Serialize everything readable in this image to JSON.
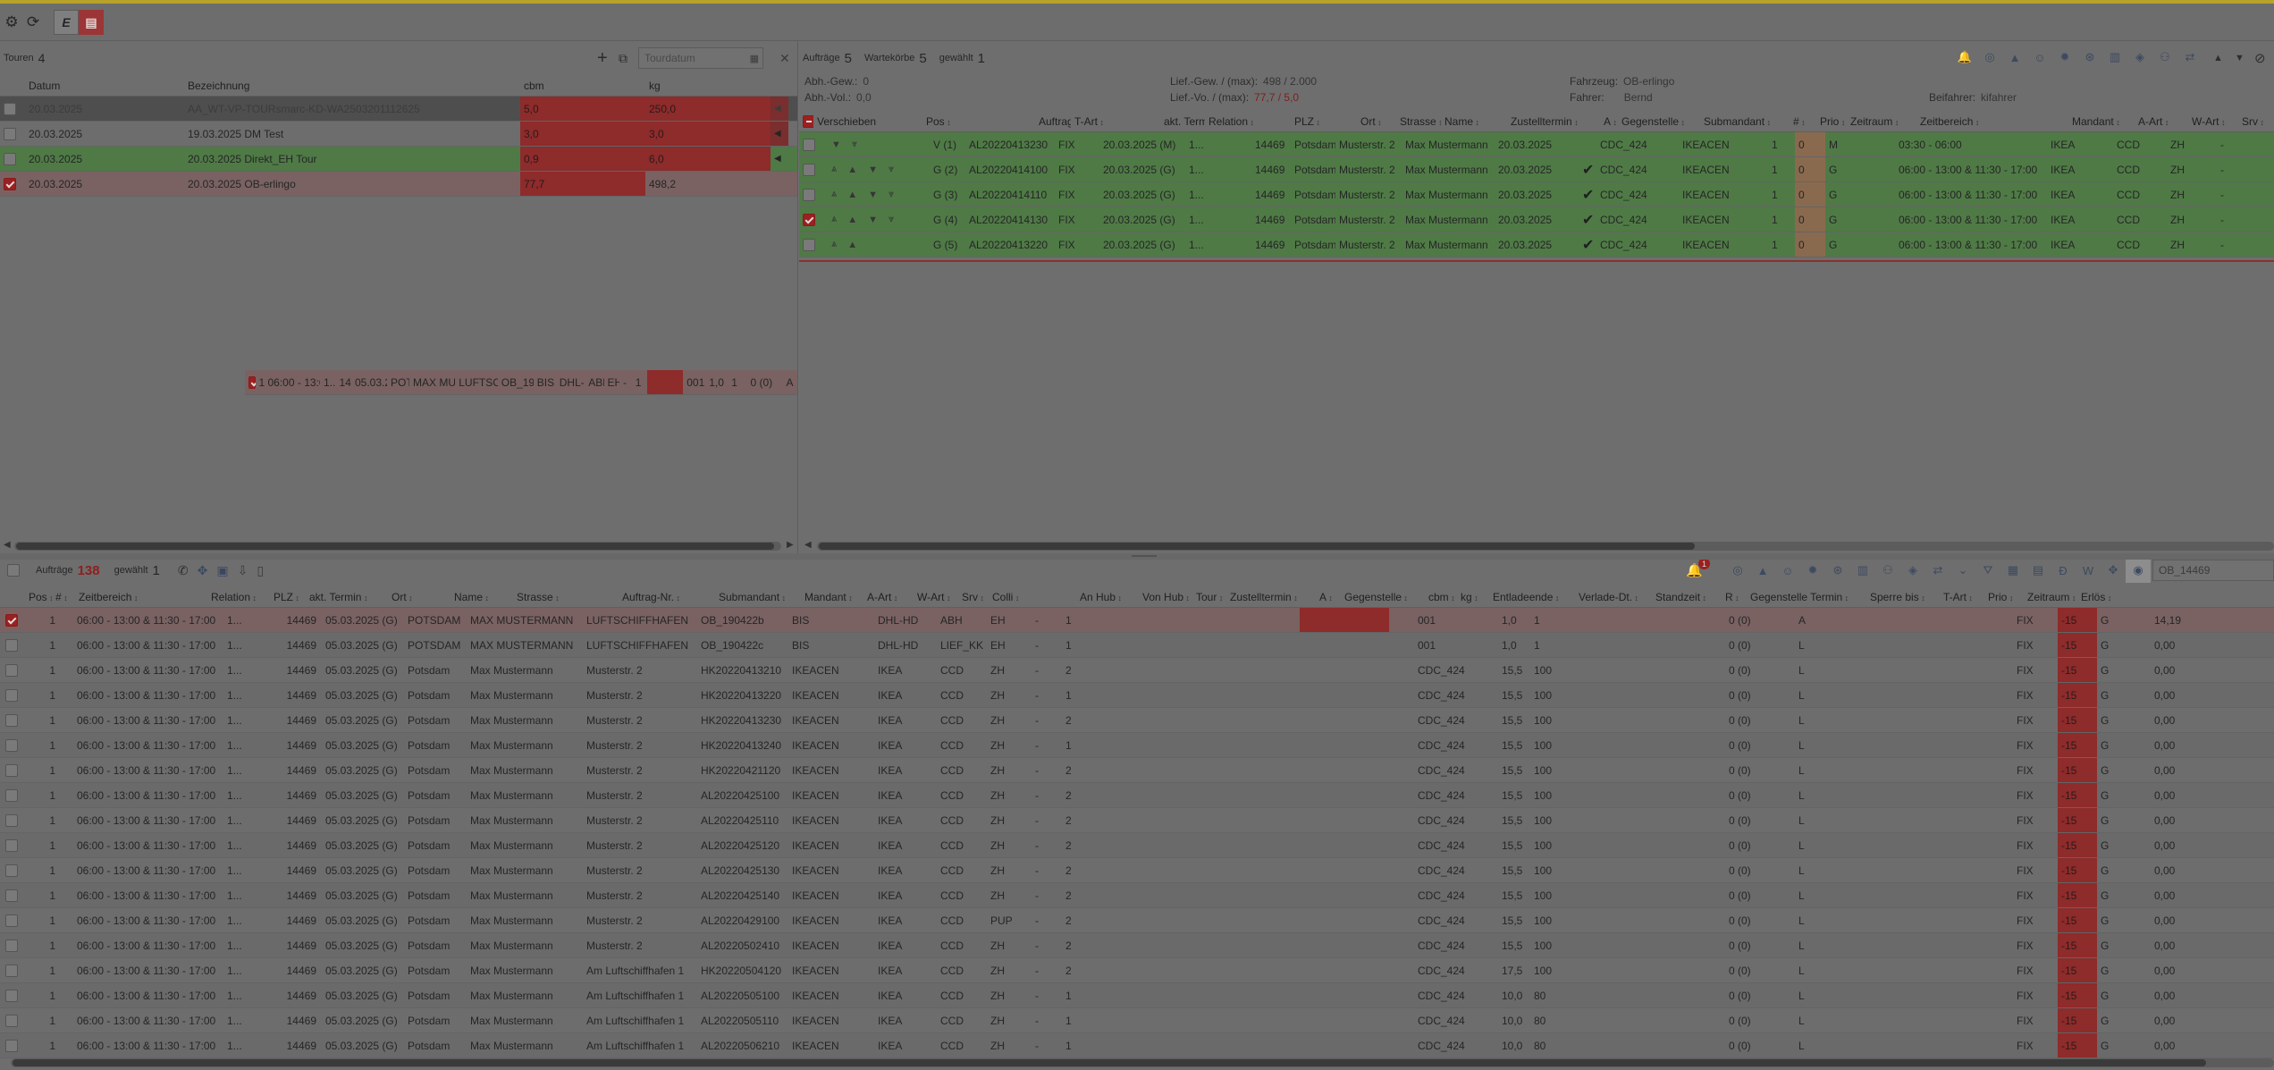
{
  "toolbar": {
    "settings_icon": "gear-icon",
    "refresh_icon": "refresh-icon",
    "tab_e_label": "E",
    "tab_active_icon": "form-icon"
  },
  "tours": {
    "label": "Touren",
    "count": "4",
    "search_placeholder": "Tourdatum",
    "columns": [
      "Datum",
      "Bezeichnung",
      "cbm",
      "kg"
    ],
    "rows": [
      {
        "datum": "20.03.2025",
        "bezeichnung": "AA_WT-VP-TOURsmarc-KD-WA2503201112625",
        "cbm": "5,0",
        "kg": "250,0",
        "style": "dark",
        "checked": false
      },
      {
        "datum": "20.03.2025",
        "bezeichnung": "19.03.2025 DM Test",
        "cbm": "3,0",
        "kg": "3,0",
        "style": "plain",
        "checked": false
      },
      {
        "datum": "20.03.2025",
        "bezeichnung": "20.03.2025 Direkt_EH Tour",
        "cbm": "0,9",
        "kg": "6,0",
        "style": "green",
        "checked": false
      },
      {
        "datum": "20.03.2025",
        "bezeichnung": "20.03.2025 OB-erlingo",
        "cbm": "77,7",
        "kg": "498,2",
        "style": "sel",
        "checked": true
      }
    ],
    "stray_row": [
      "1",
      "06:00 - 13:00 & 11:30 - 17:00",
      "1...",
      "14469",
      "05.03.2025 (G)",
      "POTSDAM",
      "MAX MUSTERMANN",
      "LUFTSCHIFFHAFEN",
      "OB_190422b",
      "BIS",
      "DHL-HD",
      "ABH",
      "EH",
      "-",
      "1",
      "001",
      "1,0",
      "1",
      "0 (0)",
      "A"
    ]
  },
  "orders_top": {
    "auftraege_label": "Aufträge",
    "auftraege_count": "5",
    "wartekoerbe_label": "Wartekörbe",
    "wartekoerbe_count": "5",
    "gewaehlt_label": "gewählt",
    "gewaehlt_count": "1",
    "info": [
      {
        "k": "Abh.-Gew.:",
        "v": "0"
      },
      {
        "k": "Abh.-Vol.:",
        "v": "0,0"
      },
      {
        "k": "Lief.-Gew. / (max):",
        "v": "498 / 2.000"
      },
      {
        "k": "Lief.-Vo. / (max):",
        "v": "77,7 / 5,0"
      },
      {
        "k": "Fahrzeug:",
        "v": "OB-erlingo"
      },
      {
        "k": "Fahrer:",
        "v": "Bernd"
      },
      {
        "k": "Beifahrer:",
        "v": "kifahrer"
      }
    ],
    "columns": [
      "Verschieben",
      "Pos",
      "Auftrag-Nr.",
      "T-Art",
      "akt. Termin",
      "Relation",
      "PLZ",
      "Ort",
      "Strasse",
      "Name",
      "Zustelltermin",
      "A",
      "Gegenstelle",
      "Submandant",
      "#",
      "Prio",
      "Zeitraum",
      "Zeitbereich",
      "Mandant",
      "A-Art",
      "W-Art",
      "Srv"
    ],
    "rows": [
      {
        "pos": "V (1)",
        "auftrag": "AL20220413230",
        "tart": "FIX",
        "termin": "20.03.2025 (M)",
        "relation": "1...",
        "plz": "14469",
        "ort": "Potsdam",
        "strasse": "Musterstr. 2",
        "name": "Max Mustermann",
        "zustell": "20.03.2025",
        "a": "",
        "gegen": "CDC_424",
        "sub": "IKEACEN",
        "num": "1",
        "prio": "0",
        "zeitraum": "M",
        "zeitbereich": "03:30 - 06:00",
        "mandant": "IKEA",
        "aart": "CCD",
        "wart": "ZH",
        "srv": "-",
        "checked": false
      },
      {
        "pos": "G (2)",
        "auftrag": "AL20220414100",
        "tart": "FIX",
        "termin": "20.03.2025 (G)",
        "relation": "1...",
        "plz": "14469",
        "ort": "Potsdam",
        "strasse": "Musterstr. 2",
        "name": "Max Mustermann",
        "zustell": "20.03.2025",
        "a": "✔",
        "gegen": "CDC_424",
        "sub": "IKEACEN",
        "num": "1",
        "prio": "0",
        "zeitraum": "G",
        "zeitbereich": "06:00 - 13:00 & 11:30 - 17:00",
        "mandant": "IKEA",
        "aart": "CCD",
        "wart": "ZH",
        "srv": "-",
        "checked": false
      },
      {
        "pos": "G (3)",
        "auftrag": "AL20220414110",
        "tart": "FIX",
        "termin": "20.03.2025 (G)",
        "relation": "1...",
        "plz": "14469",
        "ort": "Potsdam",
        "strasse": "Musterstr. 2",
        "name": "Max Mustermann",
        "zustell": "20.03.2025",
        "a": "✔",
        "gegen": "CDC_424",
        "sub": "IKEACEN",
        "num": "1",
        "prio": "0",
        "zeitraum": "G",
        "zeitbereich": "06:00 - 13:00 & 11:30 - 17:00",
        "mandant": "IKEA",
        "aart": "CCD",
        "wart": "ZH",
        "srv": "-",
        "checked": false
      },
      {
        "pos": "G (4)",
        "auftrag": "AL20220414130",
        "tart": "FIX",
        "termin": "20.03.2025 (G)",
        "relation": "1...",
        "plz": "14469",
        "ort": "Potsdam",
        "strasse": "Musterstr. 2",
        "name": "Max Mustermann",
        "zustell": "20.03.2025",
        "a": "✔",
        "gegen": "CDC_424",
        "sub": "IKEACEN",
        "num": "1",
        "prio": "0",
        "zeitraum": "G",
        "zeitbereich": "06:00 - 13:00 & 11:30 - 17:00",
        "mandant": "IKEA",
        "aart": "CCD",
        "wart": "ZH",
        "srv": "-",
        "checked": true
      },
      {
        "pos": "G (5)",
        "auftrag": "AL20220413220",
        "tart": "FIX",
        "termin": "20.03.2025 (G)",
        "relation": "1...",
        "plz": "14469",
        "ort": "Potsdam",
        "strasse": "Musterstr. 2",
        "name": "Max Mustermann",
        "zustell": "20.03.2025",
        "a": "✔",
        "gegen": "CDC_424",
        "sub": "IKEACEN",
        "num": "1",
        "prio": "0",
        "zeitraum": "G",
        "zeitbereich": "06:00 - 13:00 & 11:30 - 17:00",
        "mandant": "IKEA",
        "aart": "CCD",
        "wart": "ZH",
        "srv": "-",
        "checked": false
      }
    ]
  },
  "orders_bottom": {
    "auftraege_label": "Aufträge",
    "auftraege_count": "138",
    "gewaehlt_label": "gewählt",
    "gewaehlt_count": "1",
    "notification_count": "1",
    "search_value": "OB_14469",
    "columns": [
      "Pos",
      "#",
      "Zeitbereich",
      "Relation",
      "PLZ",
      "akt. Termin",
      "Ort",
      "Name",
      "Strasse",
      "Auftrag-Nr.",
      "Submandant",
      "Mandant",
      "A-Art",
      "W-Art",
      "Srv",
      "Colli",
      "An Hub",
      "Von Hub",
      "Tour",
      "Zustelltermin",
      "A",
      "Gegenstelle",
      "cbm",
      "kg",
      "Entladeende",
      "Verlade-Dt.",
      "Standzeit",
      "R",
      "Gegenstelle Termin",
      "Sperre bis",
      "T-Art",
      "Prio",
      "Zeitraum",
      "Erlös"
    ],
    "rows": [
      [
        "1",
        "06:00 - 13:00 & 11:30 - 17:00",
        "1...",
        "14469",
        "05.03.2025 (G)",
        "POTSDAM",
        "MAX MUSTERMANN",
        "LUFTSCHIFFHAFEN",
        "OB_190422b",
        "BIS",
        "DHL-HD",
        "ABH",
        "EH",
        "-",
        "1",
        "001",
        "1,0",
        "1",
        "0 (0)",
        "A",
        "FIX",
        "-15",
        "G",
        "14,19"
      ],
      [
        "1",
        "06:00 - 13:00 & 11:30 - 17:00",
        "1...",
        "14469",
        "05.03.2025 (G)",
        "POTSDAM",
        "MAX MUSTERMANN",
        "LUFTSCHIFFHAFEN",
        "OB_190422c",
        "BIS",
        "DHL-HD",
        "LIEF_KK",
        "EH",
        "-",
        "1",
        "001",
        "1,0",
        "1",
        "0 (0)",
        "L",
        "FIX",
        "-15",
        "G",
        "0,00"
      ],
      [
        "1",
        "06:00 - 13:00 & 11:30 - 17:00",
        "1...",
        "14469",
        "05.03.2025 (G)",
        "Potsdam",
        "Max Mustermann",
        "Musterstr. 2",
        "HK20220413210",
        "IKEACEN",
        "IKEA",
        "CCD",
        "ZH",
        "-",
        "2",
        "CDC_424",
        "15,5",
        "100",
        "0 (0)",
        "L",
        "FIX",
        "-15",
        "G",
        "0,00"
      ],
      [
        "1",
        "06:00 - 13:00 & 11:30 - 17:00",
        "1...",
        "14469",
        "05.03.2025 (G)",
        "Potsdam",
        "Max Mustermann",
        "Musterstr. 2",
        "HK20220413220",
        "IKEACEN",
        "IKEA",
        "CCD",
        "ZH",
        "-",
        "1",
        "CDC_424",
        "15,5",
        "100",
        "0 (0)",
        "L",
        "FIX",
        "-15",
        "G",
        "0,00"
      ],
      [
        "1",
        "06:00 - 13:00 & 11:30 - 17:00",
        "1...",
        "14469",
        "05.03.2025 (G)",
        "Potsdam",
        "Max Mustermann",
        "Musterstr. 2",
        "HK20220413230",
        "IKEACEN",
        "IKEA",
        "CCD",
        "ZH",
        "-",
        "2",
        "CDC_424",
        "15,5",
        "100",
        "0 (0)",
        "L",
        "FIX",
        "-15",
        "G",
        "0,00"
      ],
      [
        "1",
        "06:00 - 13:00 & 11:30 - 17:00",
        "1...",
        "14469",
        "05.03.2025 (G)",
        "Potsdam",
        "Max Mustermann",
        "Musterstr. 2",
        "HK20220413240",
        "IKEACEN",
        "IKEA",
        "CCD",
        "ZH",
        "-",
        "1",
        "CDC_424",
        "15,5",
        "100",
        "0 (0)",
        "L",
        "FIX",
        "-15",
        "G",
        "0,00"
      ],
      [
        "1",
        "06:00 - 13:00 & 11:30 - 17:00",
        "1...",
        "14469",
        "05.03.2025 (G)",
        "Potsdam",
        "Max Mustermann",
        "Musterstr. 2",
        "HK20220421120",
        "IKEACEN",
        "IKEA",
        "CCD",
        "ZH",
        "-",
        "2",
        "CDC_424",
        "15,5",
        "100",
        "0 (0)",
        "L",
        "FIX",
        "-15",
        "G",
        "0,00"
      ],
      [
        "1",
        "06:00 - 13:00 & 11:30 - 17:00",
        "1...",
        "14469",
        "05.03.2025 (G)",
        "Potsdam",
        "Max Mustermann",
        "Musterstr. 2",
        "AL20220425100",
        "IKEACEN",
        "IKEA",
        "CCD",
        "ZH",
        "-",
        "2",
        "CDC_424",
        "15,5",
        "100",
        "0 (0)",
        "L",
        "FIX",
        "-15",
        "G",
        "0,00"
      ],
      [
        "1",
        "06:00 - 13:00 & 11:30 - 17:00",
        "1...",
        "14469",
        "05.03.2025 (G)",
        "Potsdam",
        "Max Mustermann",
        "Musterstr. 2",
        "AL20220425110",
        "IKEACEN",
        "IKEA",
        "CCD",
        "ZH",
        "-",
        "2",
        "CDC_424",
        "15,5",
        "100",
        "0 (0)",
        "L",
        "FIX",
        "-15",
        "G",
        "0,00"
      ],
      [
        "1",
        "06:00 - 13:00 & 11:30 - 17:00",
        "1...",
        "14469",
        "05.03.2025 (G)",
        "Potsdam",
        "Max Mustermann",
        "Musterstr. 2",
        "AL20220425120",
        "IKEACEN",
        "IKEA",
        "CCD",
        "ZH",
        "-",
        "2",
        "CDC_424",
        "15,5",
        "100",
        "0 (0)",
        "L",
        "FIX",
        "-15",
        "G",
        "0,00"
      ],
      [
        "1",
        "06:00 - 13:00 & 11:30 - 17:00",
        "1...",
        "14469",
        "05.03.2025 (G)",
        "Potsdam",
        "Max Mustermann",
        "Musterstr. 2",
        "AL20220425130",
        "IKEACEN",
        "IKEA",
        "CCD",
        "ZH",
        "-",
        "2",
        "CDC_424",
        "15,5",
        "100",
        "0 (0)",
        "L",
        "FIX",
        "-15",
        "G",
        "0,00"
      ],
      [
        "1",
        "06:00 - 13:00 & 11:30 - 17:00",
        "1...",
        "14469",
        "05.03.2025 (G)",
        "Potsdam",
        "Max Mustermann",
        "Musterstr. 2",
        "AL20220425140",
        "IKEACEN",
        "IKEA",
        "CCD",
        "ZH",
        "-",
        "2",
        "CDC_424",
        "15,5",
        "100",
        "0 (0)",
        "L",
        "FIX",
        "-15",
        "G",
        "0,00"
      ],
      [
        "1",
        "06:00 - 13:00 & 11:30 - 17:00",
        "1...",
        "14469",
        "05.03.2025 (G)",
        "Potsdam",
        "Max Mustermann",
        "Musterstr. 2",
        "AL20220429100",
        "IKEACEN",
        "IKEA",
        "CCD",
        "PUP",
        "-",
        "2",
        "CDC_424",
        "15,5",
        "100",
        "0 (0)",
        "L",
        "FIX",
        "-15",
        "G",
        "0,00"
      ],
      [
        "1",
        "06:00 - 13:00 & 11:30 - 17:00",
        "1...",
        "14469",
        "05.03.2025 (G)",
        "Potsdam",
        "Max Mustermann",
        "Musterstr. 2",
        "AL20220502410",
        "IKEACEN",
        "IKEA",
        "CCD",
        "ZH",
        "-",
        "2",
        "CDC_424",
        "15,5",
        "100",
        "0 (0)",
        "L",
        "FIX",
        "-15",
        "G",
        "0,00"
      ],
      [
        "1",
        "06:00 - 13:00 & 11:30 - 17:00",
        "1...",
        "14469",
        "05.03.2025 (G)",
        "Potsdam",
        "Max Mustermann",
        "Am Luftschiffhafen 1",
        "HK20220504120",
        "IKEACEN",
        "IKEA",
        "CCD",
        "ZH",
        "-",
        "2",
        "CDC_424",
        "17,5",
        "100",
        "0 (0)",
        "L",
        "FIX",
        "-15",
        "G",
        "0,00"
      ],
      [
        "1",
        "06:00 - 13:00 & 11:30 - 17:00",
        "1...",
        "14469",
        "05.03.2025 (G)",
        "Potsdam",
        "Max Mustermann",
        "Am Luftschiffhafen 1",
        "AL20220505100",
        "IKEACEN",
        "IKEA",
        "CCD",
        "ZH",
        "-",
        "1",
        "CDC_424",
        "10,0",
        "80",
        "0 (0)",
        "L",
        "FIX",
        "-15",
        "G",
        "0,00"
      ],
      [
        "1",
        "06:00 - 13:00 & 11:30 - 17:00",
        "1...",
        "14469",
        "05.03.2025 (G)",
        "Potsdam",
        "Max Mustermann",
        "Am Luftschiffhafen 1",
        "AL20220505110",
        "IKEACEN",
        "IKEA",
        "CCD",
        "ZH",
        "-",
        "1",
        "CDC_424",
        "10,0",
        "80",
        "0 (0)",
        "L",
        "FIX",
        "-15",
        "G",
        "0,00"
      ],
      [
        "1",
        "06:00 - 13:00 & 11:30 - 17:00",
        "1...",
        "14469",
        "05.03.2025 (G)",
        "Potsdam",
        "Max Mustermann",
        "Am Luftschiffhafen 1",
        "AL20220506210",
        "IKEACEN",
        "IKEA",
        "CCD",
        "ZH",
        "-",
        "1",
        "CDC_424",
        "10,0",
        "80",
        "0 (0)",
        "L",
        "FIX",
        "-15",
        "G",
        "0,00"
      ]
    ]
  }
}
